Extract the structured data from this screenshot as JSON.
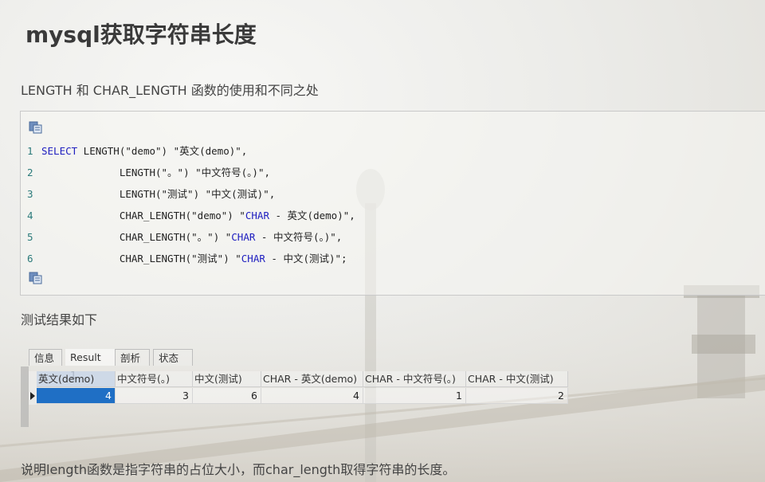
{
  "article": {
    "title": "mysql获取字符串长度",
    "intro": "LENGTH 和 CHAR_LENGTH 函数的使用和不同之处",
    "results_label": "测试结果如下",
    "conclusion": "说明length函数是指字符串的占位大小，而char_length取得字符串的长度。"
  },
  "code": {
    "copy_icon": "copy-code-icon",
    "lines": [
      {
        "num": "1",
        "keyword": "SELECT",
        "text": " LENGTH(\"demo\") \"英文(demo)\",",
        "keyword2": "",
        "text2": ""
      },
      {
        "num": "2",
        "keyword": "",
        "text": "             LENGTH(\"。\") \"中文符号(。)\",",
        "keyword2": "",
        "text2": ""
      },
      {
        "num": "3",
        "keyword": "",
        "text": "             LENGTH(\"测试\") \"中文(测试)\",",
        "keyword2": "",
        "text2": ""
      },
      {
        "num": "4",
        "keyword": "",
        "text": "             CHAR_LENGTH(\"demo\") \"",
        "keyword2": "CHAR",
        "text2": " - 英文(demo)\","
      },
      {
        "num": "5",
        "keyword": "",
        "text": "             CHAR_LENGTH(\"。\") \"",
        "keyword2": "CHAR",
        "text2": " - 中文符号(。)\","
      },
      {
        "num": "6",
        "keyword": "",
        "text": "             CHAR_LENGTH(\"测试\") \"",
        "keyword2": "CHAR",
        "text2": " - 中文(测试)\";"
      }
    ]
  },
  "result_grid": {
    "tabs": [
      "信息",
      "Result 1",
      "剖析",
      "状态"
    ],
    "active_tab": "Result 1",
    "columns": [
      "英文(demo)",
      "中文符号(。)",
      "中文(测试)",
      "CHAR - 英文(demo)",
      "CHAR - 中文符号(。)",
      "CHAR - 中文(测试)"
    ],
    "rows": [
      [
        "4",
        "3",
        "6",
        "4",
        "1",
        "2"
      ]
    ],
    "selected_color": "#1f6fc5"
  }
}
